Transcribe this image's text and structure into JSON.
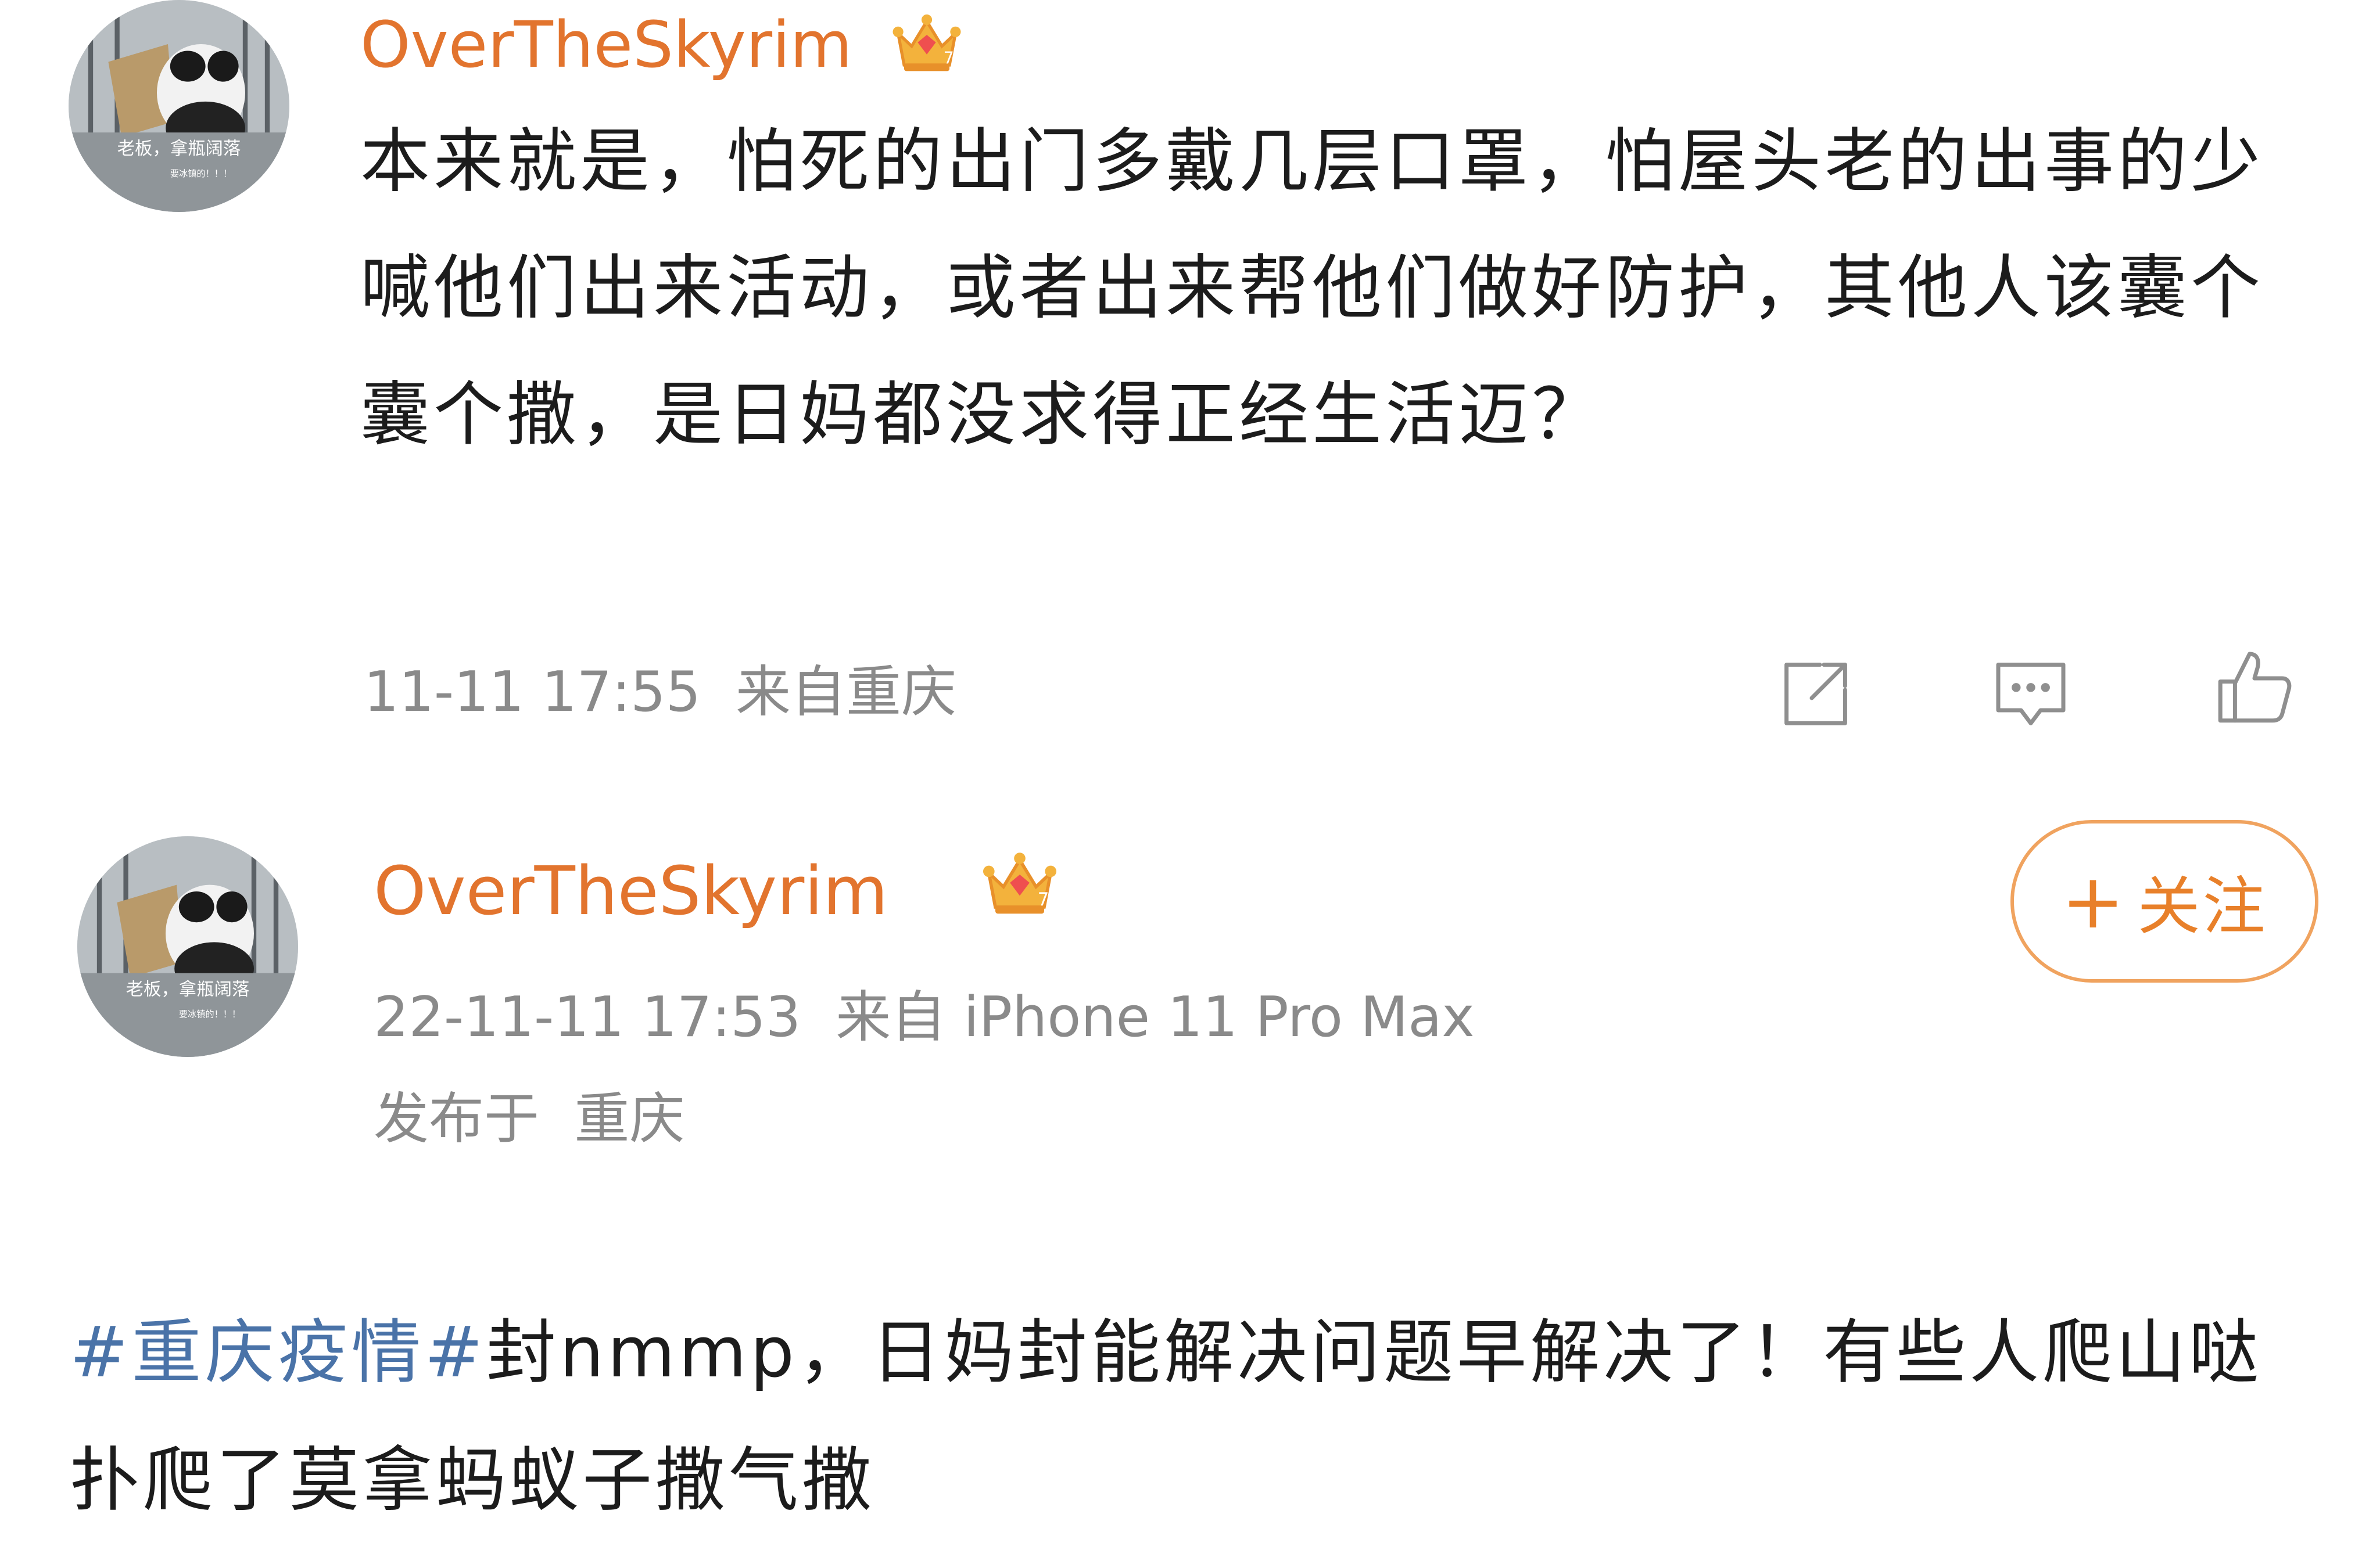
{
  "comment": {
    "username": "OverTheSkyrim",
    "text": "本来就是，怕死的出门多戴几层口罩，怕屋头老的出事的少喊他们出来活动，或者出来帮他们做好防护，其他人该囊个囊个撒，是日妈都没求得正经生活迈？",
    "timestamp": "11-11 17:55",
    "source": "来自重庆",
    "avatar_text": "老板，拿瓶阔落",
    "avatar_subtext": "要冰镇的！！！",
    "icons": {
      "share": "share-icon",
      "reply": "comment-icon",
      "like": "thumbs-up-icon",
      "badge": "crown-badge-icon"
    }
  },
  "post": {
    "username": "OverTheSkyrim",
    "follow_label": "关注",
    "timestamp": "22-11-11 17:53",
    "device": "来自 iPhone 11 Pro Max",
    "location": "发布于  重庆",
    "avatar_text": "老板，拿瓶阔落",
    "avatar_subtext": "要冰镇的！！！",
    "hashtag": "#重庆疫情#",
    "body": "封nmmp，日妈封能解决问题早解决了！有些人爬山哒扑爬了莫拿蚂蚁子撒气撒"
  },
  "colors": {
    "username": "#e2742e",
    "hashtag": "#4a73a8",
    "follow_border": "#f0a35f",
    "meta": "#8a8a8a"
  }
}
